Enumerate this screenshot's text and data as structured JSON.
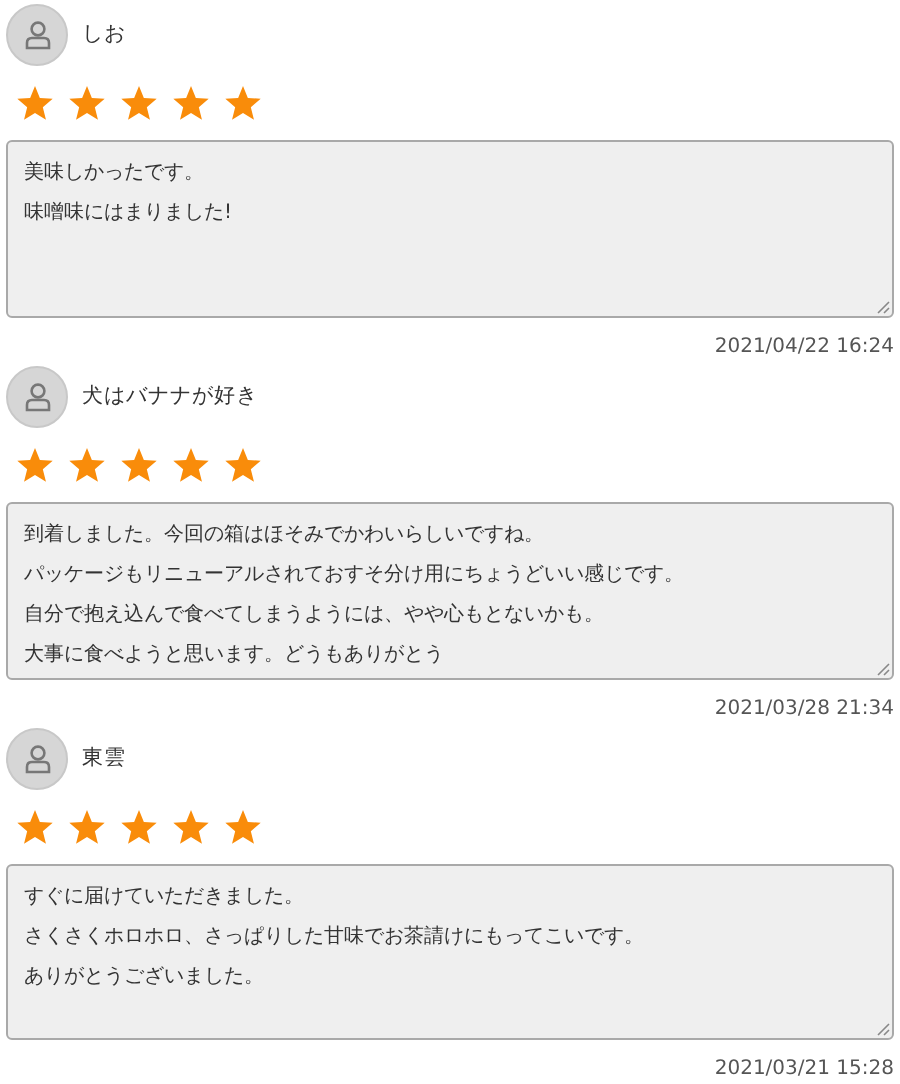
{
  "reviews": [
    {
      "name": "しお",
      "stars": 5,
      "lines": [
        "美味しかったです。",
        "味噌味にはまりました!"
      ],
      "date": "2021/04/22 16:24"
    },
    {
      "name": "犬はバナナが好き",
      "stars": 5,
      "lines": [
        "到着しました。今回の箱はほそみでかわいらしいですね。",
        "パッケージもリニューアルされておすそ分け用にちょうどいい感じです。",
        "自分で抱え込んで食べてしまうようには、やや心もとないかも。",
        "大事に食べようと思います。どうもありがとう"
      ],
      "date": "2021/03/28 21:34"
    },
    {
      "name": "東雲",
      "stars": 5,
      "lines": [
        "すぐに届けていただきました。",
        "さくさくホロホロ、さっぱりした甘味でお茶請けにもってこいです。",
        "ありがとうございました。"
      ],
      "date": "2021/03/21 15:28"
    }
  ]
}
